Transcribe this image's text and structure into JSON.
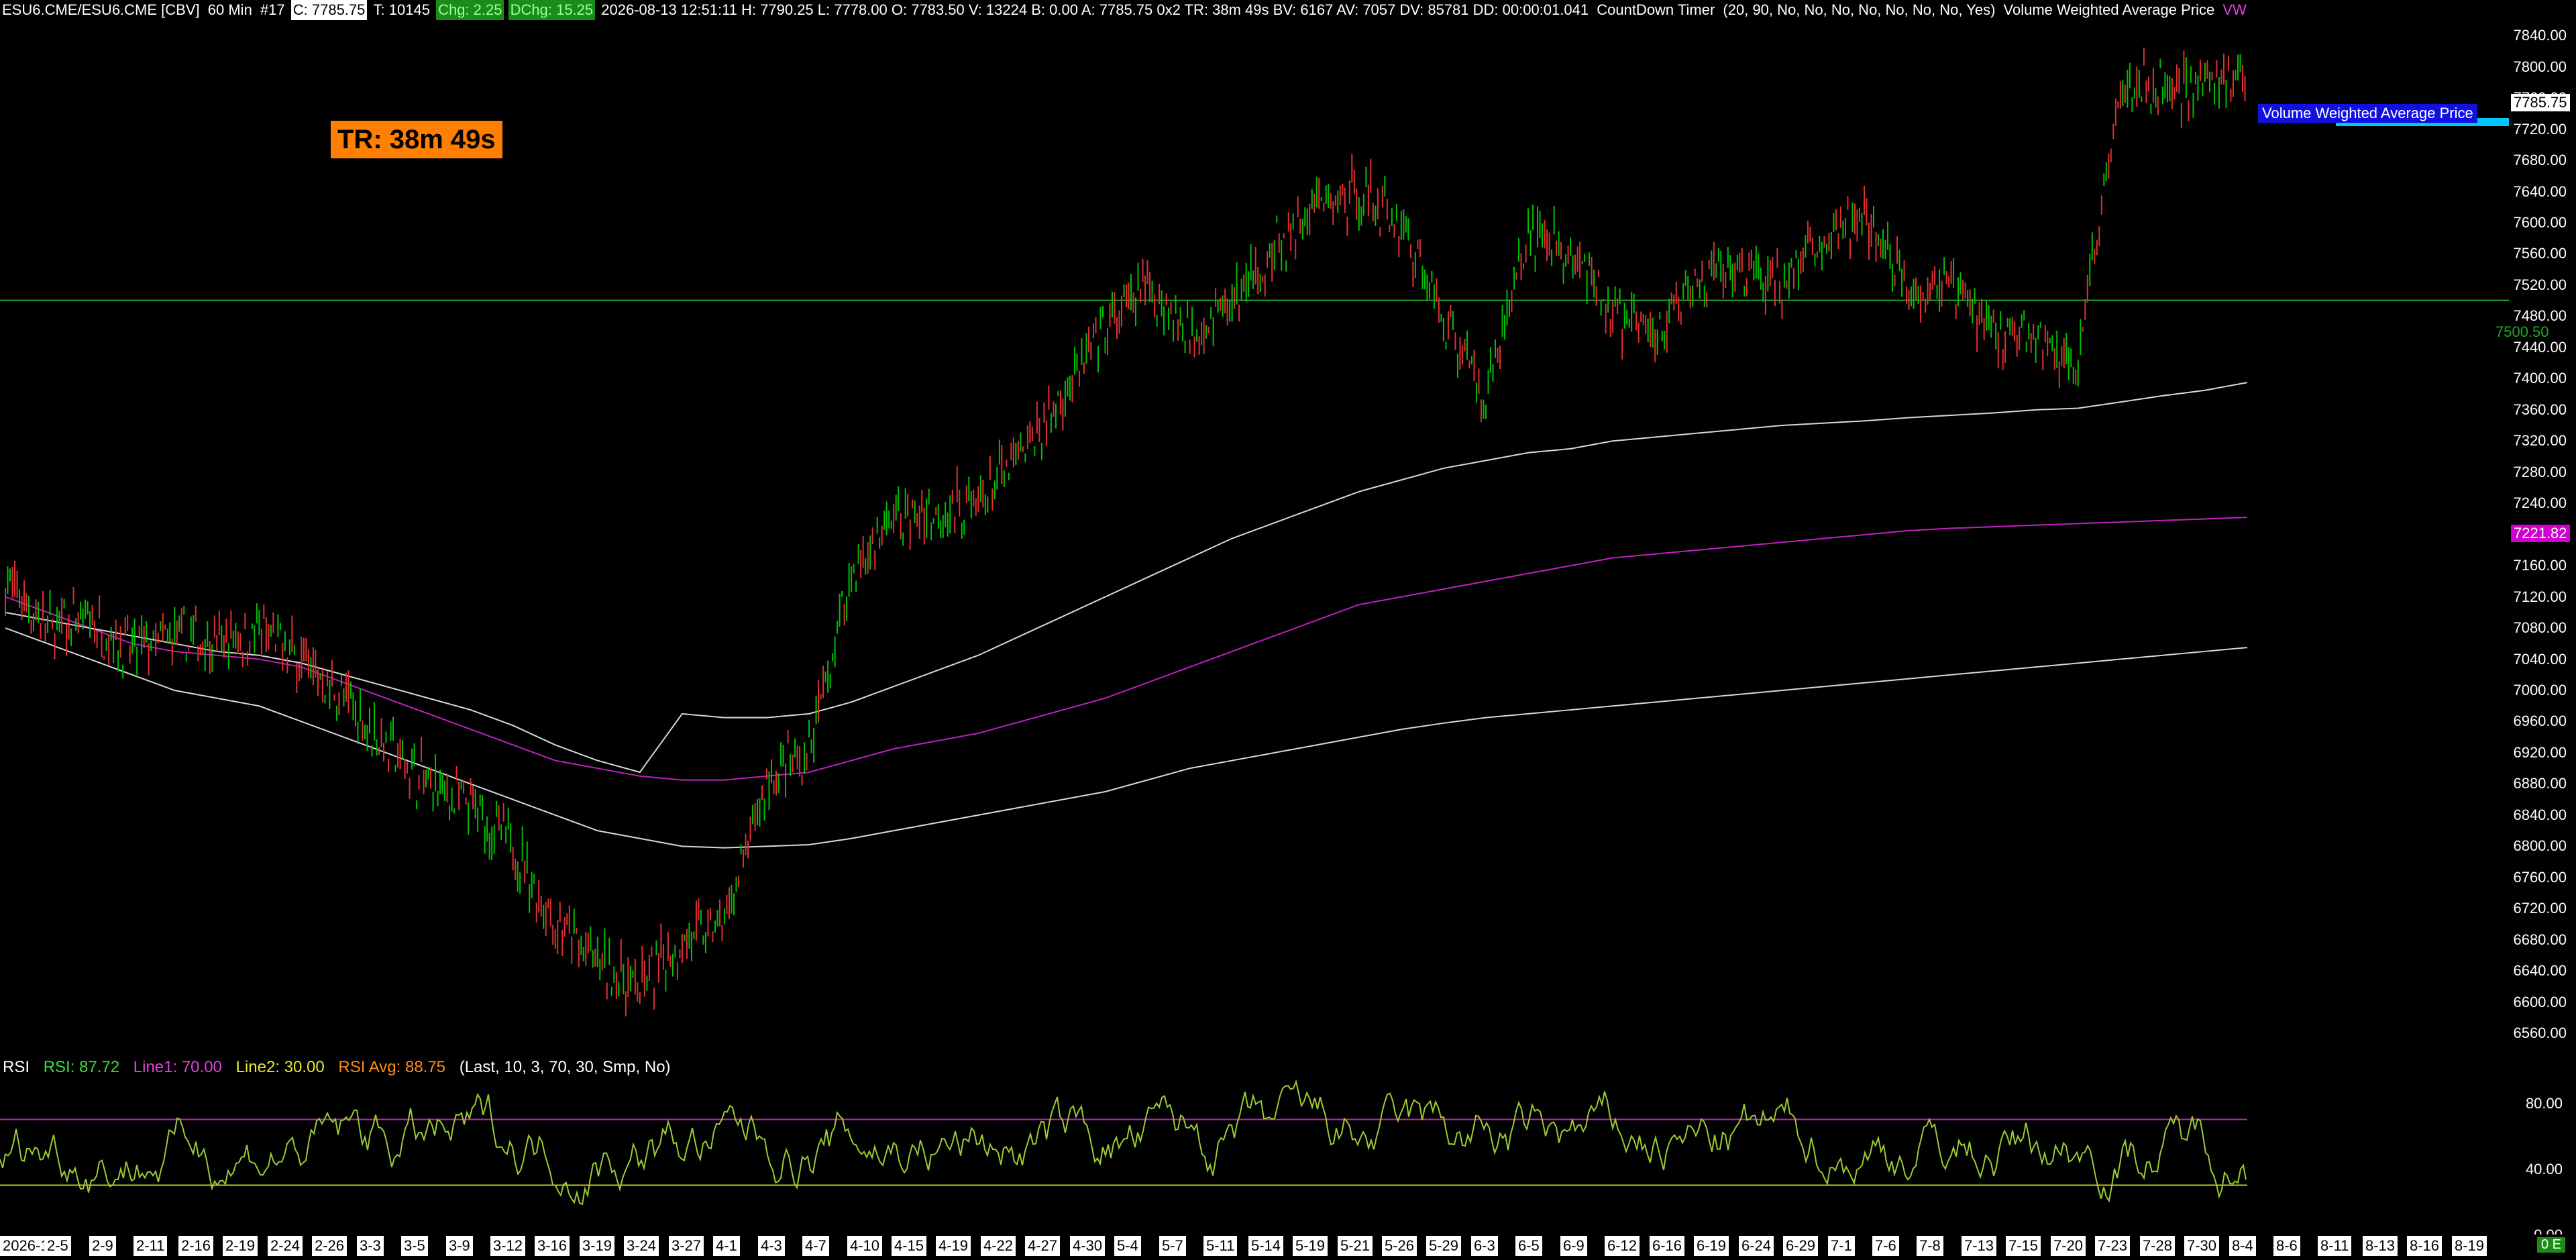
{
  "header": {
    "symbol": "ESU6.CME/ESU6.CME [CBV]",
    "interval": "60 Min",
    "chart_no": "#17",
    "close": "C: 7785.75",
    "tick": "T: 10145",
    "chg": "Chg: 2.25",
    "dchg": "DChg: 15.25",
    "info": "2026-08-13 12:51:11 H: 7790.25 L: 7778.00 O: 7783.50 V: 13224 B: 0.00 A: 7785.75 0x2 TR: 38m 49s BV: 6167 AV: 7057 DV: 85781 DD: 00:00:01.041",
    "study1": "CountDown Timer",
    "study1_params": "(20, 90, No, No, No, No, No, No, No, Yes)",
    "study2": "Volume Weighted Average Price",
    "study2_short": "VW"
  },
  "timer_badge": "TR: 38m 49s",
  "last_price_label": "7785.75",
  "vwap_flag": "Volume Weighted Average Price",
  "magenta_price_label": "7221.82",
  "hline_label": "7500.50",
  "corner_label": "0 E",
  "colors": {
    "up": "#00c000",
    "down": "#e03030",
    "ma_magenta": "#c020c0",
    "ma_white": "#d8d8d8",
    "hline": "#1faa1f",
    "rsi": "#9acd32",
    "timer": "#ff7f00"
  },
  "rsi": {
    "name": "RSI",
    "value": "RSI: 87.72",
    "line1": "Line1: 70.00",
    "line2": "Line2: 30.00",
    "avg": "RSI Avg: 88.75",
    "params": "(Last, 10, 3, 70, 30, Smp, No)",
    "ticks": [
      "80.00",
      "40.00",
      "0.00"
    ]
  },
  "y_ticks": [
    "7840.00",
    "7800.00",
    "7760.00",
    "7720.00",
    "7680.00",
    "7640.00",
    "7600.00",
    "7560.00",
    "7520.00",
    "7480.00",
    "7440.00",
    "7400.00",
    "7360.00",
    "7320.00",
    "7280.00",
    "7240.00",
    "7200.00",
    "7160.00",
    "7120.00",
    "7080.00",
    "7040.00",
    "7000.00",
    "6960.00",
    "6920.00",
    "6880.00",
    "6840.00",
    "6800.00",
    "6760.00",
    "6720.00",
    "6680.00",
    "6640.00",
    "6600.00",
    "6560.00"
  ],
  "x_labels": [
    "2026-1-28",
    "2-5",
    "2-9",
    "2-11",
    "2-16",
    "2-19",
    "2-24",
    "2-26",
    "3-3",
    "3-5",
    "3-9",
    "3-12",
    "3-16",
    "3-19",
    "3-24",
    "3-27",
    "4-1",
    "4-3",
    "4-7",
    "4-10",
    "4-15",
    "4-19",
    "4-22",
    "4-27",
    "4-30",
    "5-4",
    "5-7",
    "5-11",
    "5-14",
    "5-19",
    "5-21",
    "5-26",
    "5-29",
    "6-3",
    "6-5",
    "6-9",
    "6-12",
    "6-16",
    "6-19",
    "6-24",
    "6-29",
    "7-1",
    "7-6",
    "7-8",
    "7-13",
    "7-15",
    "7-20",
    "7-23",
    "7-28",
    "7-30",
    "8-4",
    "8-6",
    "8-11",
    "8-13",
    "8-16",
    "8-19"
  ],
  "chart_data": {
    "type": "line",
    "title": "",
    "ylim": [
      6530,
      7860
    ],
    "x": [
      "2026-1-28",
      "2-5",
      "2-9",
      "2-11",
      "2-16",
      "2-19",
      "2-24",
      "2-26",
      "3-3",
      "3-5",
      "3-9",
      "3-12",
      "3-16",
      "3-19",
      "3-24",
      "3-27",
      "4-1",
      "4-3",
      "4-7",
      "4-10",
      "4-15",
      "4-19",
      "4-22",
      "4-27",
      "4-30",
      "5-4",
      "5-7",
      "5-11",
      "5-14",
      "5-19",
      "5-21",
      "5-26",
      "5-29",
      "6-3",
      "6-5",
      "6-9",
      "6-12",
      "6-16",
      "6-19",
      "6-24",
      "6-29",
      "7-1",
      "7-6",
      "7-8",
      "7-13",
      "7-15",
      "7-20",
      "7-23",
      "7-28",
      "7-30",
      "8-4",
      "8-6",
      "8-11",
      "8-13"
    ],
    "series": [
      {
        "values": [
          7140,
          7080,
          7090,
          7050,
          7070,
          7060,
          7075,
          7040,
          6990,
          6930,
          6880,
          6850,
          6800,
          6700,
          6650,
          6620,
          6680,
          6700,
          6880,
          6920,
          7150,
          7220,
          7230,
          7240,
          7300,
          7380,
          7460,
          7520,
          7460,
          7500,
          7560,
          7620,
          7640,
          7600,
          7480,
          7380,
          7590,
          7560,
          7480,
          7460,
          7520,
          7540,
          7520,
          7580,
          7600,
          7520,
          7520,
          7460,
          7450,
          7420,
          7780,
          7770,
          7780,
          7786
        ]
      },
      {
        "values": [
          7120,
          7100,
          7080,
          7060,
          7050,
          7045,
          7040,
          7030,
          7010,
          6990,
          6970,
          6950,
          6930,
          6910,
          6900,
          6890,
          6885,
          6885,
          6890,
          6895,
          6910,
          6925,
          6935,
          6945,
          6960,
          6975,
          6990,
          7010,
          7030,
          7050,
          7070,
          7090,
          7110,
          7120,
          7130,
          7140,
          7150,
          7160,
          7170,
          7175,
          7180,
          7185,
          7190,
          7195,
          7200,
          7205,
          7208,
          7210,
          7212,
          7214,
          7216,
          7218,
          7220,
          7222
        ]
      },
      {
        "values": [
          7100,
          7090,
          7080,
          7070,
          7060,
          7050,
          7045,
          7035,
          7020,
          7005,
          6990,
          6975,
          6955,
          6930,
          6910,
          6895,
          6970,
          6965,
          6965,
          6970,
          6985,
          7005,
          7025,
          7045,
          7070,
          7095,
          7120,
          7145,
          7170,
          7195,
          7215,
          7235,
          7255,
          7270,
          7285,
          7295,
          7305,
          7310,
          7320,
          7325,
          7330,
          7335,
          7340,
          7343,
          7346,
          7350,
          7353,
          7356,
          7360,
          7362,
          7370,
          7378,
          7385,
          7395
        ]
      },
      {
        "values": [
          7080,
          7060,
          7040,
          7020,
          7000,
          6990,
          6980,
          6960,
          6940,
          6920,
          6900,
          6880,
          6860,
          6840,
          6820,
          6810,
          6800,
          6798,
          6800,
          6802,
          6810,
          6820,
          6830,
          6840,
          6850,
          6860,
          6870,
          6885,
          6900,
          6910,
          6920,
          6930,
          6940,
          6950,
          6958,
          6965,
          6970,
          6975,
          6980,
          6985,
          6990,
          6995,
          7000,
          7005,
          7010,
          7015,
          7020,
          7025,
          7030,
          7035,
          7040,
          7045,
          7050,
          7055
        ]
      }
    ],
    "hline": 7500.5,
    "rsi_ylim": [
      0,
      100
    ],
    "rsi_levels": [
      70,
      30
    ]
  }
}
